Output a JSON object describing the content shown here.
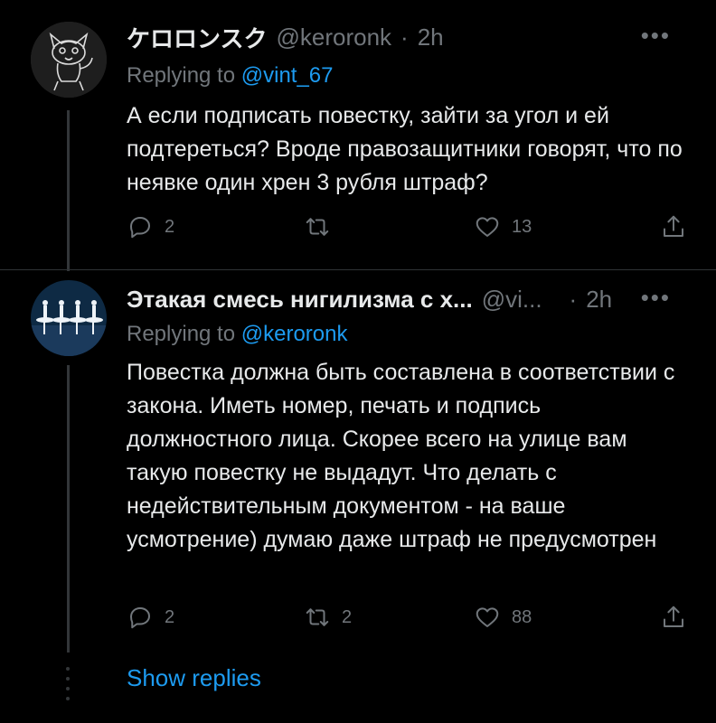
{
  "tweets": [
    {
      "name": "ケロロンスク",
      "handle": "@keroronk",
      "dot": "·",
      "time": "2h",
      "more": "•••",
      "replying_prefix": "Replying to",
      "replying_to": "@vint_67",
      "text": "А если подписать повестку, зайти за угол и ей подтереться? Вроде правозащитники говорят, что по неявке один хрен 3 рубля штраф?",
      "replies": "2",
      "retweets": "",
      "likes": "13",
      "icons": [
        "reply-icon",
        "retweet-icon",
        "like-icon",
        "share-icon"
      ]
    },
    {
      "name": "Этакая смесь нигилизма с х...",
      "handle": "@vi...",
      "dot": "·",
      "time": "2h",
      "more": "•••",
      "replying_prefix": "Replying to",
      "replying_to": "@keroronk",
      "text": "Повестка должна быть составлена в соответствии с закона. Иметь номер, печать и подпись должностного лица. Скорее всего на улице вам такую повестку не выдадут. Что делать с недействительным документом - на ваше усмотрение) думаю даже штраф не предусмотрен",
      "replies": "2",
      "retweets": "2",
      "likes": "88",
      "icons": [
        "reply-icon",
        "retweet-icon",
        "like-icon",
        "share-icon"
      ]
    }
  ],
  "show_replies": "Show replies",
  "colors": {
    "background": "#000000",
    "text": "#e7e9ea",
    "muted": "#71767b",
    "accent": "#1d9bf0"
  }
}
